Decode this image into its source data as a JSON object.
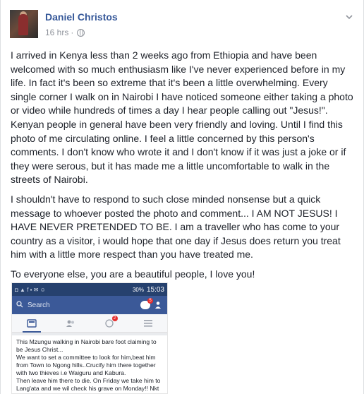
{
  "post": {
    "author": "Daniel Christos",
    "time": "16 hrs",
    "separator": "·",
    "paragraphs": [
      "I arrived in Kenya less than 2 weeks ago from Ethiopia and have been welcomed with so much enthusiasm like I've never experienced before in my life. In fact it's been so extreme that it's been a little overwhelming. Every single corner I walk on in Nairobi I have noticed someone either taking a photo or video while hundreds of times a day I hear people calling out \"Jesus!\". Kenyan people in general have been very friendly and loving. Until I find this photo of me circulating online. I feel a little concerned by this person's comments. I don't know who wrote it and I don't know if it was just a joke or if they were serous, but it has made me a little uncomfortable to walk in the streets of Nairobi.",
      "I shouldn't have to respond to such close minded nonsense but a quick message to whoever posted the photo and comment... I AM NOT JESUS! I HAVE NEVER PRETENDED TO BE. I am a traveller who has come to your country as a visitor, i would hope that one day if Jesus does return you treat him with a little more respect than you have treated me.",
      "To everyone else, you are a beautiful people, I love you!"
    ]
  },
  "screenshot": {
    "status_icons": "◘ ▲ f ▪ ✉ ☺",
    "status_right": "30%",
    "time": "15:03",
    "search_placeholder": "Search",
    "message_badge": "5",
    "notif_badge": "2",
    "post_text": "This Mzungu walking in Nairobi bare foot claiming to be Jesus Christ...\nWe want to set a committee to look for him,beat him from Town to Ngong hills..Crucify him there together with two thieves i.e Waiguru and Kabura.\nThen leave him there to die. On Friday we take him to Lang'ata and we wil check his grave on Monday!! Nkt"
  },
  "colors": {
    "link": "#365899",
    "meta": "#90949c",
    "fb_blue": "#3b5998"
  }
}
